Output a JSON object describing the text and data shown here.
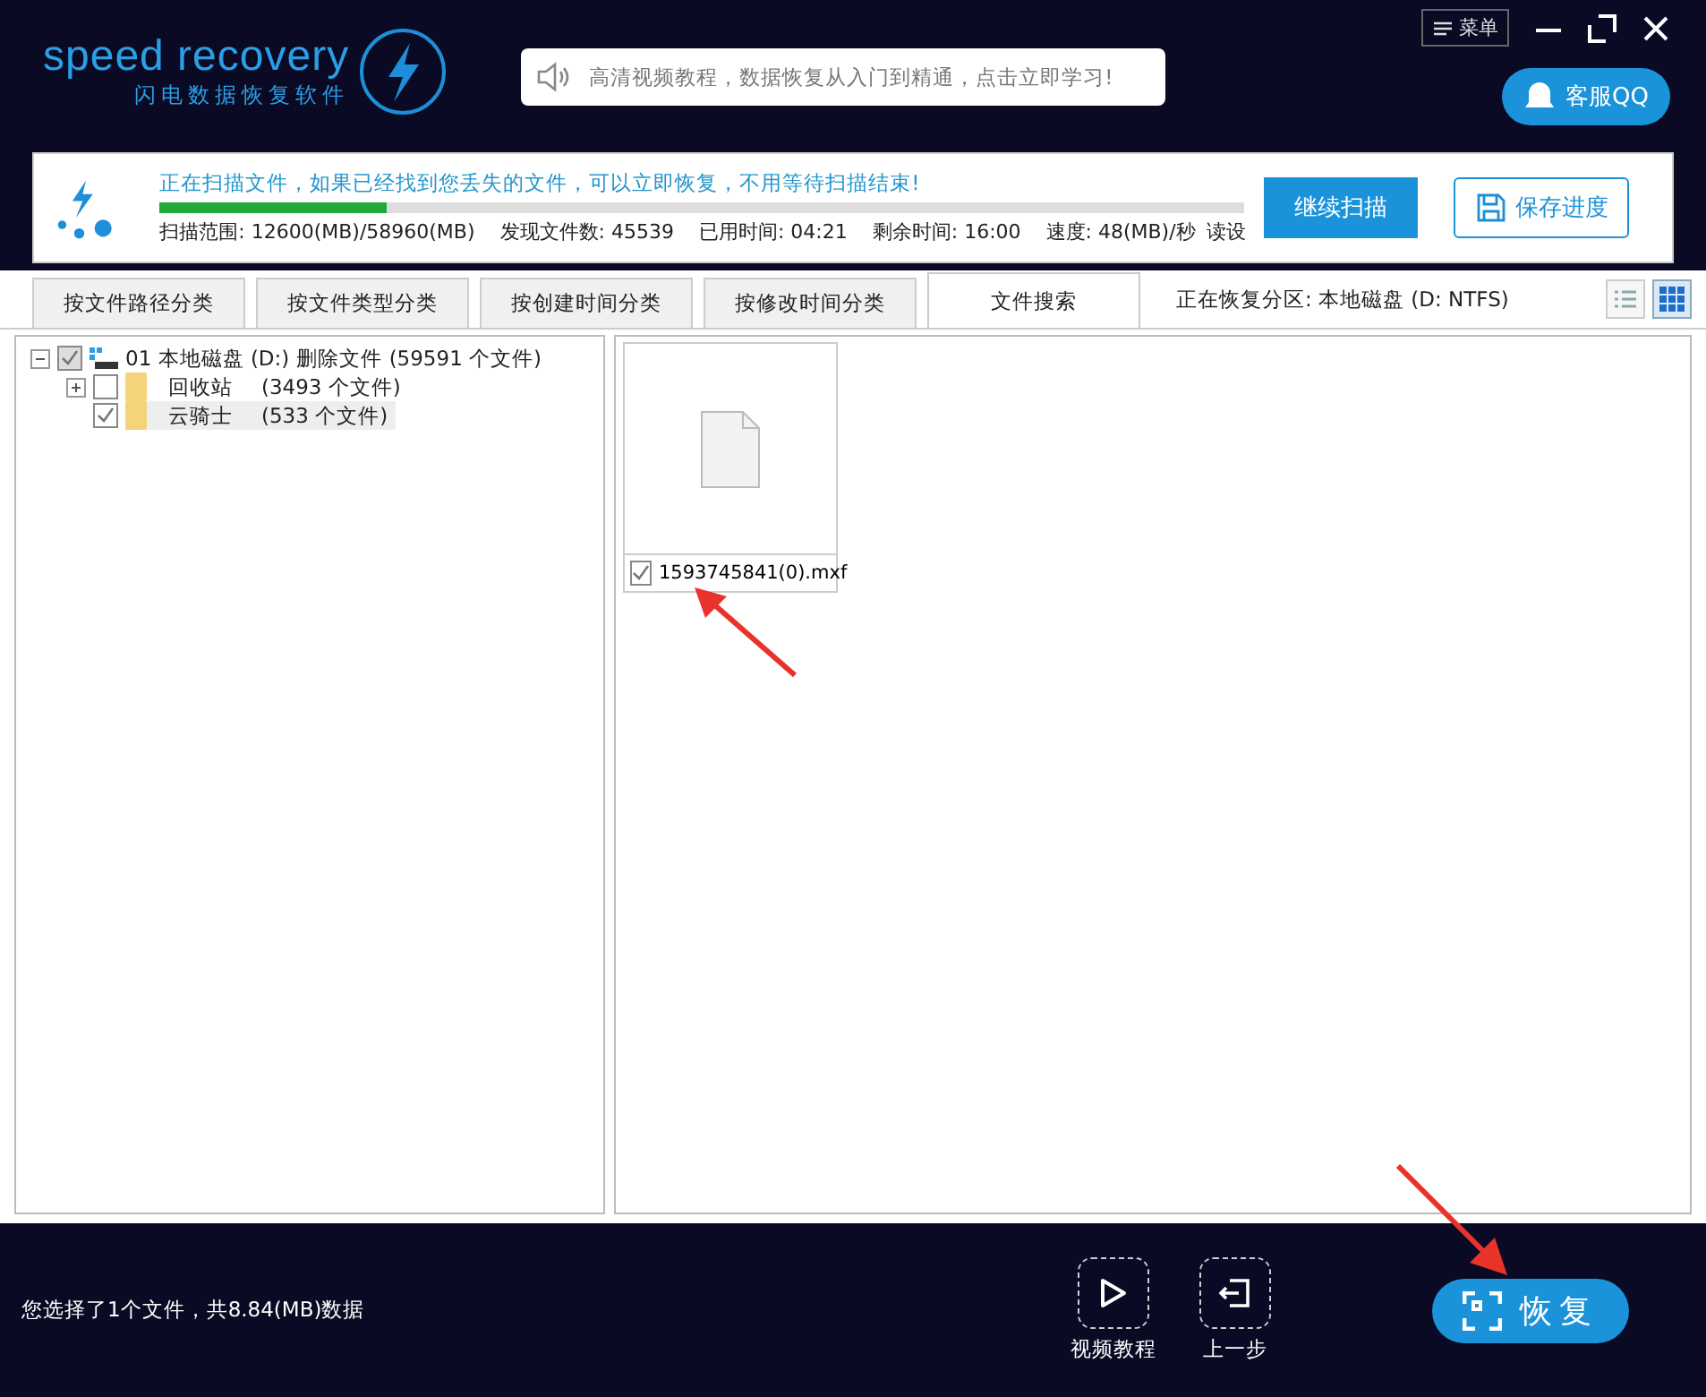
{
  "header": {
    "logo_title": "speed recovery",
    "logo_subtitle": "闪电数据恢复软件",
    "notice": "高清视频教程，数据恢复从入门到精通，点击立即学习!",
    "menu": "菜单",
    "support": "客服QQ"
  },
  "scan": {
    "message": "正在扫描文件，如果已经找到您丢失的文件，可以立即恢复，不用等待扫描结束!",
    "level": 0.21,
    "stats": [
      "扫描范围: 12600(MB)/58960(MB)",
      "发现文件数: 45539",
      "已用时间: 04:21",
      "剩余时间: 16:00",
      "速度: 48(MB)/秒",
      "读设"
    ],
    "continue_button": "继续扫描",
    "save_button": "保存进度"
  },
  "tabs": [
    {
      "label": "按文件路径分类",
      "selected": false
    },
    {
      "label": "按文件类型分类",
      "selected": false
    },
    {
      "label": "按创建时间分类",
      "selected": false
    },
    {
      "label": "按修改时间分类",
      "selected": false
    },
    {
      "label": "文件搜索",
      "selected": true
    }
  ],
  "partition": "正在恢复分区: 本地磁盘 (D: NTFS)",
  "view": {
    "grid_selected": true
  },
  "tree": {
    "label": "01 本地磁盘 (D:) 删除文件",
    "count": "(59591 个文件)",
    "checked": true,
    "expanded": true,
    "children": [
      {
        "label": "回收站",
        "count": "(3493 个文件)",
        "checked": false,
        "expandable": true,
        "selected": false
      },
      {
        "label": "云骑士",
        "count": "(533 个文件)",
        "checked": true,
        "expandable": false,
        "selected": true
      }
    ]
  },
  "files": [
    {
      "name": "1593745841(0).mxf",
      "checked": true
    }
  ],
  "footer": {
    "summary": "您选择了1个文件，共8.84(MB)数据",
    "video_button": "视频教程",
    "back_button": "上一步",
    "recover_button": "恢复"
  }
}
